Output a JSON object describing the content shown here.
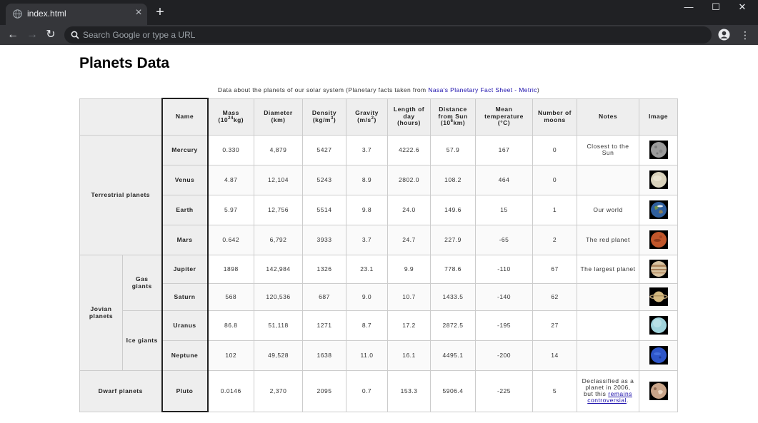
{
  "browser": {
    "tab_title": "index.html",
    "tab_close": "×",
    "new_tab": "+",
    "window_minimize": "—",
    "window_maximize": "☐",
    "window_close": "✕",
    "nav_back": "←",
    "nav_forward": "→",
    "nav_reload": "↻",
    "menu": "⋮",
    "omnibox_placeholder": "Search Google or type a URL",
    "omnibox_value": ""
  },
  "page": {
    "title": "Planets Data",
    "caption_text": "Data about the planets of our solar system (Planetary facts taken from ",
    "caption_link": "Nasa's Planetary Fact Sheet - Metric",
    "caption_end": ")"
  },
  "table": {
    "headers": {
      "name": "Name",
      "mass": "Mass (10",
      "mass_exp": "24",
      "mass_unit": "kg)",
      "diameter": "Diameter (km)",
      "density": "Density (kg/m",
      "density_exp": "3",
      "density_end": ")",
      "gravity": "Gravity (m/s",
      "gravity_exp": "2",
      "gravity_end": ")",
      "length_of_day": "Length of day (hours)",
      "distance": "Distance from Sun (10",
      "distance_exp": "6",
      "distance_unit": "km)",
      "mean_temp": "Mean temperature (°C)",
      "moons": "Number of moons",
      "notes": "Notes",
      "image": "Image"
    },
    "groups": {
      "terrestrial": "Terrestrial planets",
      "jovian": "Jovian planets",
      "gas_giants": "Gas giants",
      "ice_giants": "Ice giants",
      "dwarf": "Dwarf planets"
    },
    "rows": [
      {
        "name": "Mercury",
        "mass": "0.330",
        "diameter": "4,879",
        "density": "5427",
        "gravity": "3.7",
        "day": "4222.6",
        "distance": "57.9",
        "temp": "167",
        "moons": "0",
        "notes": "Closest to the Sun",
        "image": "mercury-image"
      },
      {
        "name": "Venus",
        "mass": "4.87",
        "diameter": "12,104",
        "density": "5243",
        "gravity": "8.9",
        "day": "2802.0",
        "distance": "108.2",
        "temp": "464",
        "moons": "0",
        "notes": "",
        "image": "venus-image"
      },
      {
        "name": "Earth",
        "mass": "5.97",
        "diameter": "12,756",
        "density": "5514",
        "gravity": "9.8",
        "day": "24.0",
        "distance": "149.6",
        "temp": "15",
        "moons": "1",
        "notes": "Our world",
        "image": "earth-image"
      },
      {
        "name": "Mars",
        "mass": "0.642",
        "diameter": "6,792",
        "density": "3933",
        "gravity": "3.7",
        "day": "24.7",
        "distance": "227.9",
        "temp": "-65",
        "moons": "2",
        "notes": "The red planet",
        "image": "mars-image"
      },
      {
        "name": "Jupiter",
        "mass": "1898",
        "diameter": "142,984",
        "density": "1326",
        "gravity": "23.1",
        "day": "9.9",
        "distance": "778.6",
        "temp": "-110",
        "moons": "67",
        "notes": "The largest planet",
        "image": "jupiter-image"
      },
      {
        "name": "Saturn",
        "mass": "568",
        "diameter": "120,536",
        "density": "687",
        "gravity": "9.0",
        "day": "10.7",
        "distance": "1433.5",
        "temp": "-140",
        "moons": "62",
        "notes": "",
        "image": "saturn-image"
      },
      {
        "name": "Uranus",
        "mass": "86.8",
        "diameter": "51,118",
        "density": "1271",
        "gravity": "8.7",
        "day": "17.2",
        "distance": "2872.5",
        "temp": "-195",
        "moons": "27",
        "notes": "",
        "image": "uranus-image"
      },
      {
        "name": "Neptune",
        "mass": "102",
        "diameter": "49,528",
        "density": "1638",
        "gravity": "11.0",
        "day": "16.1",
        "distance": "4495.1",
        "temp": "-200",
        "moons": "14",
        "notes": "",
        "image": "neptune-image"
      },
      {
        "name": "Pluto",
        "mass": "0.0146",
        "diameter": "2,370",
        "density": "2095",
        "gravity": "0.7",
        "day": "153.3",
        "distance": "5906.4",
        "temp": "-225",
        "moons": "5",
        "notes_text": "Declassified as a planet in 2006, but this ",
        "notes_link": "remains controversial",
        "notes_end": ".",
        "image": "pluto-image"
      }
    ]
  },
  "colors": {
    "chrome_dark": "#202124",
    "chrome_mid": "#35363a",
    "link": "#1a0dab",
    "header_bg": "#eeeeee"
  }
}
